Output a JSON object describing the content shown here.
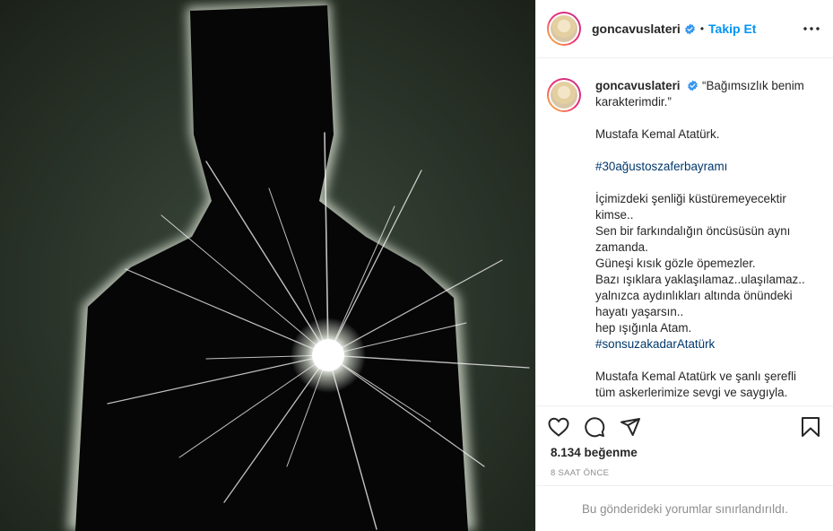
{
  "post": {
    "username": "goncavuslateri",
    "follow_label": "Takip Et",
    "dot": "•",
    "caption": {
      "line1": "“Bağımsızlık benim karakterimdir.”",
      "line2": "Mustafa Kemal Atatürk.",
      "hashtag1": "#30ağustoszaferbayramı",
      "p1": "İçimizdeki şenliği küstüremeyecektir kimse..",
      "p2": "Sen bir farkındalığın öncüsüsün aynı zamanda.",
      "p3": "Güneşi kısık gözle öpemezler.",
      "p4": "Bazı ışıklara yaklaşılamaz..ulaşılamaz..",
      "p5": "yalnızca aydınlıkları altında önündeki hayatı yaşarsın..",
      "p6": "hep ışığınla Atam.",
      "hashtag2": "#sonsuzakadarAtatürk",
      "p7": "Mustafa Kemal Atatürk ve şanlı şerefli tüm askerlerimize sevgi ve saygıyla."
    },
    "likes": "8.134 beğenme",
    "time": "8 saat önce",
    "comments_disabled": "Bu gönderideki yorumlar sınırlandırıldı."
  },
  "icons": {
    "verified": "verified-badge-icon",
    "more": "more-options-icon",
    "like": "heart-icon",
    "comment": "comment-icon",
    "share": "share-icon",
    "save": "bookmark-icon"
  },
  "colors": {
    "link_blue": "#0095f6",
    "hashtag": "#00376b",
    "muted": "#8e8e8e",
    "border": "#efefef"
  }
}
